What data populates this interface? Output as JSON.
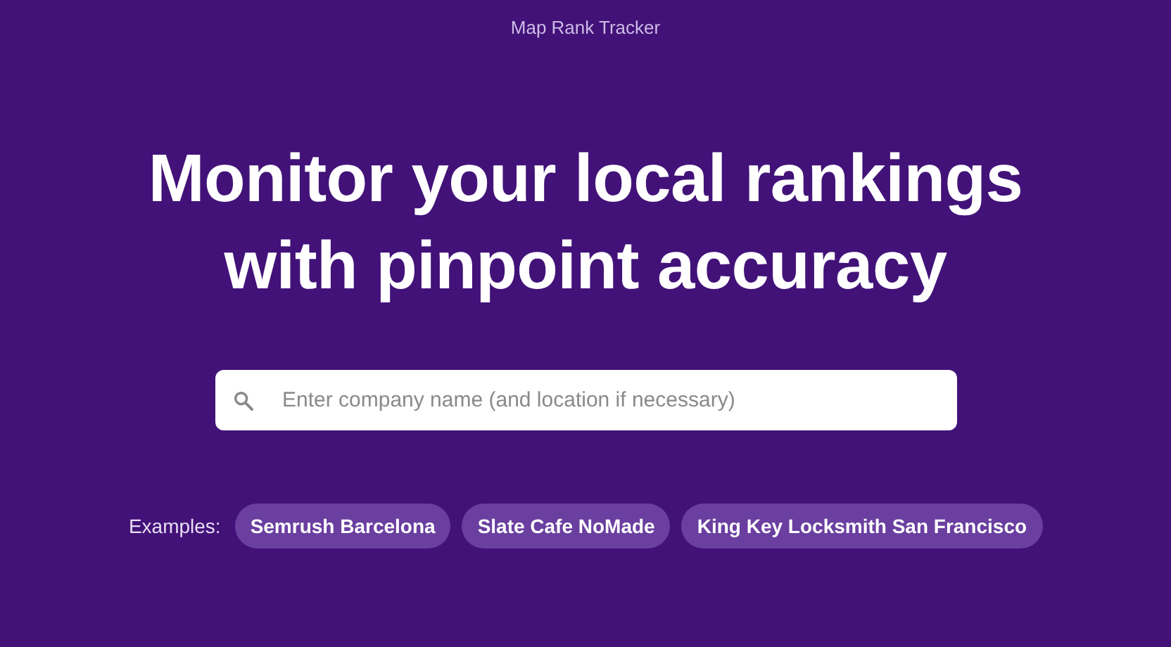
{
  "header": {
    "title": "Map Rank Tracker"
  },
  "hero": {
    "heading": "Monitor your local rankings with pinpoint accuracy"
  },
  "search": {
    "placeholder": "Enter company name (and location if necessary)"
  },
  "examples": {
    "label": "Examples:",
    "items": [
      "Semrush Barcelona",
      "Slate Cafe NoMade",
      "King Key Locksmith San Francisco"
    ]
  }
}
